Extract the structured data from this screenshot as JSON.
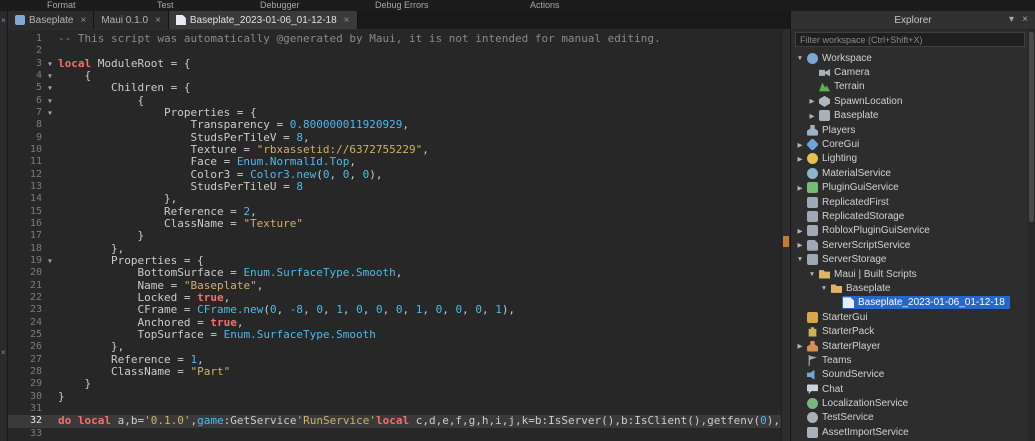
{
  "colors": {
    "selection": "#2667CB",
    "warning_marker": "#C87A2E"
  },
  "menubar": {
    "items": [
      "Format",
      "Test",
      "Debugger",
      "Debug Errors",
      "Actions"
    ]
  },
  "side_strip": {
    "close_top": "×",
    "close_bottom": "×"
  },
  "tabs": [
    {
      "label": "Baseplate",
      "icon": "place-icon",
      "close": "×",
      "active": false
    },
    {
      "label": "Maui 0.1.0",
      "icon": null,
      "close": "×",
      "active": false
    },
    {
      "label": "Baseplate_2023-01-06_01-12-18",
      "icon": "script-icon",
      "close": "×",
      "active": true
    }
  ],
  "editor": {
    "syntax_colors": {
      "p": "#CCCCCC",
      "c": "#8A8A8A",
      "k": "#F4706A",
      "s": "#D0B266",
      "n": "#4FB9E8",
      "b": "#4FB9E8"
    },
    "lines": [
      {
        "n": 1,
        "fold": false,
        "current": false,
        "segs": [
          [
            "c",
            "-- This script was automatically @generated by Maui, it is not intended for manual editing."
          ]
        ]
      },
      {
        "n": 2,
        "fold": false,
        "current": false,
        "segs": []
      },
      {
        "n": 3,
        "fold": true,
        "current": false,
        "segs": [
          [
            "k",
            "local"
          ],
          [
            "p",
            " ModuleRoot = {"
          ]
        ]
      },
      {
        "n": 4,
        "fold": true,
        "current": false,
        "segs": [
          [
            "p",
            "    {"
          ]
        ]
      },
      {
        "n": 5,
        "fold": true,
        "current": false,
        "segs": [
          [
            "p",
            "        Children = {"
          ]
        ]
      },
      {
        "n": 6,
        "fold": true,
        "current": false,
        "segs": [
          [
            "p",
            "            {"
          ]
        ]
      },
      {
        "n": 7,
        "fold": true,
        "current": false,
        "segs": [
          [
            "p",
            "                Properties = {"
          ]
        ]
      },
      {
        "n": 8,
        "fold": false,
        "current": false,
        "segs": [
          [
            "p",
            "                    Transparency = "
          ],
          [
            "n",
            "0.800000011920929"
          ],
          [
            "p",
            ","
          ]
        ]
      },
      {
        "n": 9,
        "fold": false,
        "current": false,
        "segs": [
          [
            "p",
            "                    StudsPerTileV = "
          ],
          [
            "n",
            "8"
          ],
          [
            "p",
            ","
          ]
        ]
      },
      {
        "n": 10,
        "fold": false,
        "current": false,
        "segs": [
          [
            "p",
            "                    Texture = "
          ],
          [
            "s",
            "\"rbxassetid://6372755229\""
          ],
          [
            "p",
            ","
          ]
        ]
      },
      {
        "n": 11,
        "fold": false,
        "current": false,
        "segs": [
          [
            "p",
            "                    Face = "
          ],
          [
            "b",
            "Enum.NormalId.Top"
          ],
          [
            "p",
            ","
          ]
        ]
      },
      {
        "n": 12,
        "fold": false,
        "current": false,
        "segs": [
          [
            "p",
            "                    Color3 = "
          ],
          [
            "b",
            "Color3.new"
          ],
          [
            "p",
            "("
          ],
          [
            "n",
            "0"
          ],
          [
            "p",
            ", "
          ],
          [
            "n",
            "0"
          ],
          [
            "p",
            ", "
          ],
          [
            "n",
            "0"
          ],
          [
            "p",
            "),"
          ]
        ]
      },
      {
        "n": 13,
        "fold": false,
        "current": false,
        "segs": [
          [
            "p",
            "                    StudsPerTileU = "
          ],
          [
            "n",
            "8"
          ]
        ]
      },
      {
        "n": 14,
        "fold": false,
        "current": false,
        "segs": [
          [
            "p",
            "                },"
          ]
        ]
      },
      {
        "n": 15,
        "fold": false,
        "current": false,
        "segs": [
          [
            "p",
            "                Reference = "
          ],
          [
            "n",
            "2"
          ],
          [
            "p",
            ","
          ]
        ]
      },
      {
        "n": 16,
        "fold": false,
        "current": false,
        "segs": [
          [
            "p",
            "                ClassName = "
          ],
          [
            "s",
            "\"Texture\""
          ]
        ]
      },
      {
        "n": 17,
        "fold": false,
        "current": false,
        "segs": [
          [
            "p",
            "            }"
          ]
        ]
      },
      {
        "n": 18,
        "fold": false,
        "current": false,
        "segs": [
          [
            "p",
            "        },"
          ]
        ]
      },
      {
        "n": 19,
        "fold": true,
        "current": false,
        "segs": [
          [
            "p",
            "        Properties = {"
          ]
        ]
      },
      {
        "n": 20,
        "fold": false,
        "current": false,
        "segs": [
          [
            "p",
            "            BottomSurface = "
          ],
          [
            "b",
            "Enum.SurfaceType.Smooth"
          ],
          [
            "p",
            ","
          ]
        ]
      },
      {
        "n": 21,
        "fold": false,
        "current": false,
        "segs": [
          [
            "p",
            "            Name = "
          ],
          [
            "s",
            "\"Baseplate\""
          ],
          [
            "p",
            ","
          ]
        ]
      },
      {
        "n": 22,
        "fold": false,
        "current": false,
        "segs": [
          [
            "p",
            "            Locked = "
          ],
          [
            "k",
            "true"
          ],
          [
            "p",
            ","
          ]
        ]
      },
      {
        "n": 23,
        "fold": false,
        "current": false,
        "segs": [
          [
            "p",
            "            CFrame = "
          ],
          [
            "b",
            "CFrame.new"
          ],
          [
            "p",
            "("
          ],
          [
            "n",
            "0"
          ],
          [
            "p",
            ", "
          ],
          [
            "n",
            "-8"
          ],
          [
            "p",
            ", "
          ],
          [
            "n",
            "0"
          ],
          [
            "p",
            ", "
          ],
          [
            "n",
            "1"
          ],
          [
            "p",
            ", "
          ],
          [
            "n",
            "0"
          ],
          [
            "p",
            ", "
          ],
          [
            "n",
            "0"
          ],
          [
            "p",
            ", "
          ],
          [
            "n",
            "0"
          ],
          [
            "p",
            ", "
          ],
          [
            "n",
            "1"
          ],
          [
            "p",
            ", "
          ],
          [
            "n",
            "0"
          ],
          [
            "p",
            ", "
          ],
          [
            "n",
            "0"
          ],
          [
            "p",
            ", "
          ],
          [
            "n",
            "0"
          ],
          [
            "p",
            ", "
          ],
          [
            "n",
            "1"
          ],
          [
            "p",
            "),"
          ]
        ]
      },
      {
        "n": 24,
        "fold": false,
        "current": false,
        "segs": [
          [
            "p",
            "            Anchored = "
          ],
          [
            "k",
            "true"
          ],
          [
            "p",
            ","
          ]
        ]
      },
      {
        "n": 25,
        "fold": false,
        "current": false,
        "segs": [
          [
            "p",
            "            TopSurface = "
          ],
          [
            "b",
            "Enum.SurfaceType.Smooth"
          ]
        ]
      },
      {
        "n": 26,
        "fold": false,
        "current": false,
        "segs": [
          [
            "p",
            "        },"
          ]
        ]
      },
      {
        "n": 27,
        "fold": false,
        "current": false,
        "segs": [
          [
            "p",
            "        Reference = "
          ],
          [
            "n",
            "1"
          ],
          [
            "p",
            ","
          ]
        ]
      },
      {
        "n": 28,
        "fold": false,
        "current": false,
        "segs": [
          [
            "p",
            "        ClassName = "
          ],
          [
            "s",
            "\"Part\""
          ]
        ]
      },
      {
        "n": 29,
        "fold": false,
        "current": false,
        "segs": [
          [
            "p",
            "    }"
          ]
        ]
      },
      {
        "n": 30,
        "fold": false,
        "current": false,
        "segs": [
          [
            "p",
            "}"
          ]
        ]
      },
      {
        "n": 31,
        "fold": false,
        "current": false,
        "segs": []
      },
      {
        "n": 32,
        "fold": false,
        "current": true,
        "segs": [
          [
            "k",
            "do"
          ],
          [
            "p",
            " "
          ],
          [
            "k",
            "local"
          ],
          [
            "p",
            " a,b="
          ],
          [
            "s",
            "'0.1.0'"
          ],
          [
            "p",
            ","
          ],
          [
            "b",
            "game"
          ],
          [
            "p",
            ":GetService"
          ],
          [
            "s",
            "'RunService'"
          ],
          [
            "k",
            "local"
          ],
          [
            "p",
            " c,d,e,f,g,h,i,j,k=b:IsServer(),b:IsClient(),getfenv("
          ],
          [
            "n",
            "0"
          ],
          [
            "p",
            "),"
          ]
        ]
      },
      {
        "n": 33,
        "fold": false,
        "current": false,
        "segs": []
      }
    ]
  },
  "explorer": {
    "title": "Explorer",
    "collapse_icon": "▾",
    "close_icon": "×",
    "filter_placeholder": "Filter workspace (Ctrl+Shift+X)",
    "tree": [
      {
        "label": "Workspace",
        "depth": 0,
        "arrow": "v",
        "icon": "workspace",
        "selected": false
      },
      {
        "label": "Camera",
        "depth": 1,
        "arrow": "",
        "icon": "camera",
        "selected": false
      },
      {
        "label": "Terrain",
        "depth": 1,
        "arrow": "",
        "icon": "terrain",
        "selected": false
      },
      {
        "label": "SpawnLocation",
        "depth": 1,
        "arrow": ">",
        "icon": "spawnlocation",
        "selected": false
      },
      {
        "label": "Baseplate",
        "depth": 1,
        "arrow": ">",
        "icon": "part",
        "selected": false
      },
      {
        "label": "Players",
        "depth": 0,
        "arrow": "",
        "icon": "players",
        "selected": false
      },
      {
        "label": "CoreGui",
        "depth": 0,
        "arrow": ">",
        "icon": "coregui",
        "selected": false
      },
      {
        "label": "Lighting",
        "depth": 0,
        "arrow": ">",
        "icon": "lighting",
        "selected": false
      },
      {
        "label": "MaterialService",
        "depth": 0,
        "arrow": "",
        "icon": "materialservice",
        "selected": false
      },
      {
        "label": "PluginGuiService",
        "depth": 0,
        "arrow": ">",
        "icon": "pluginguiservice",
        "selected": false
      },
      {
        "label": "ReplicatedFirst",
        "depth": 0,
        "arrow": "",
        "icon": "replicatedfirst",
        "selected": false
      },
      {
        "label": "ReplicatedStorage",
        "depth": 0,
        "arrow": "",
        "icon": "replicatedstorage",
        "selected": false
      },
      {
        "label": "RobloxPluginGuiService",
        "depth": 0,
        "arrow": ">",
        "icon": "robloxpluginguiservice",
        "selected": false
      },
      {
        "label": "ServerScriptService",
        "depth": 0,
        "arrow": ">",
        "icon": "serverscriptservice",
        "selected": false
      },
      {
        "label": "ServerStorage",
        "depth": 0,
        "arrow": "v",
        "icon": "serverstorage",
        "selected": false
      },
      {
        "label": "Maui | Built Scripts",
        "depth": 1,
        "arrow": "v",
        "icon": "folder",
        "selected": false
      },
      {
        "label": "Baseplate",
        "depth": 2,
        "arrow": "v",
        "icon": "folder",
        "selected": false
      },
      {
        "label": "Baseplate_2023-01-06_01-12-18",
        "depth": 3,
        "arrow": "",
        "icon": "script",
        "selected": true
      },
      {
        "label": "StarterGui",
        "depth": 0,
        "arrow": "",
        "icon": "startergui",
        "selected": false
      },
      {
        "label": "StarterPack",
        "depth": 0,
        "arrow": "",
        "icon": "starterpack",
        "selected": false
      },
      {
        "label": "StarterPlayer",
        "depth": 0,
        "arrow": ">",
        "icon": "starterplayer",
        "selected": false
      },
      {
        "label": "Teams",
        "depth": 0,
        "arrow": "",
        "icon": "teams",
        "selected": false
      },
      {
        "label": "SoundService",
        "depth": 0,
        "arrow": "",
        "icon": "soundservice",
        "selected": false
      },
      {
        "label": "Chat",
        "depth": 0,
        "arrow": "",
        "icon": "chat",
        "selected": false
      },
      {
        "label": "LocalizationService",
        "depth": 0,
        "arrow": "",
        "icon": "localizationservice",
        "selected": false
      },
      {
        "label": "TestService",
        "depth": 0,
        "arrow": "",
        "icon": "testservice",
        "selected": false
      },
      {
        "label": "AssetImportService",
        "depth": 0,
        "arrow": "",
        "icon": "assetimportservice",
        "selected": false
      }
    ]
  }
}
